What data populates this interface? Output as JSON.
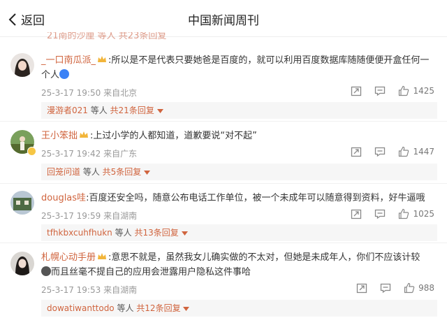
{
  "header": {
    "back_label": "返回",
    "title": "中国新闻周刊"
  },
  "peek_text": "21南的沙厘 等人 共23条回复",
  "comments": [
    {
      "username": "_一口南瓜派_",
      "text": ":所以是不是代表只要她爸是百度的，就可以利用百度数据库随随便便开盒任何一个人",
      "time": "25-3-17 19:50",
      "location": "来自北京",
      "likes": "1425",
      "reply_user": "漫游者021",
      "reply_mid": " 等人 ",
      "reply_count": "共21条回复"
    },
    {
      "username": "王小笨拙",
      "text": ":上过小学的人都知道，道歉要说“对不起”",
      "time": "25-3-17 19:42",
      "location": "来自广东",
      "likes": "1447",
      "reply_user": "回笼问道",
      "reply_mid": " 等人 ",
      "reply_count": "共5条回复"
    },
    {
      "username": "douglas哇",
      "text": ":百度还安全吗，随意公布电话工作单位，被一个未成年可以随意得到资料，好牛逼哦",
      "time": "25-3-17 19:59",
      "location": "来自湖南",
      "likes": "1025",
      "reply_user": "tfhkbxcuhfhukn",
      "reply_mid": " 等人 ",
      "reply_count": "共13条回复"
    },
    {
      "username": "札幌心动手册",
      "text": ":意思不就是，虽然我女儿确实做的不太对，但她是未成年人，你们不应该计较",
      "text2": "而且丝毫不提自己的应用会泄露用户隐私这件事哈",
      "time": "25-3-17 19:53",
      "location": "来自湖南",
      "likes": "988",
      "reply_user": "dowatiwanttodo",
      "reply_mid": " 等人 ",
      "reply_count": "共12条回复"
    }
  ],
  "icons": {
    "back": "chevron-left-icon",
    "repost": "repost-icon",
    "comment": "comment-icon",
    "like": "thumbs-up-icon",
    "dropdown": "caret-down-icon"
  },
  "colors": {
    "username": "#d0643e",
    "meta": "#999999",
    "reply_bg": "#f6f6f6"
  }
}
